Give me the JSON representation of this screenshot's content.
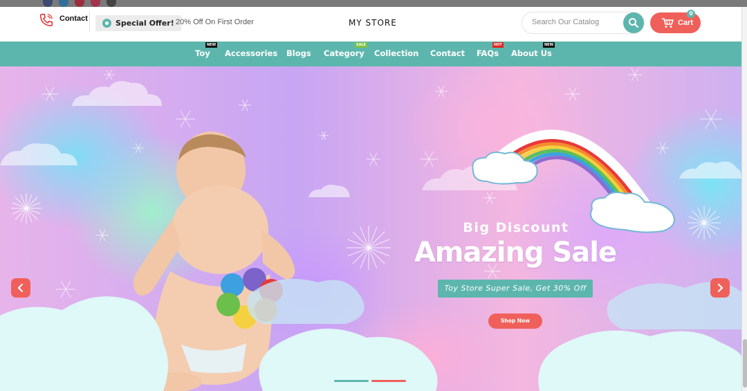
{
  "header": {
    "contact_label": "Contact",
    "special_offer_label": "Special Offer!",
    "offer_text": "20% Off On First Order",
    "store_title": "MY STORE",
    "search_placeholder": "Search Our Catalog",
    "cart_label": "Cart",
    "cart_count": "0"
  },
  "nav": {
    "items": [
      {
        "label": "Toy",
        "tag": "NEW"
      },
      {
        "label": "Accessories",
        "tag": ""
      },
      {
        "label": "Blogs",
        "tag": ""
      },
      {
        "label": "Category",
        "tag": "SALE"
      },
      {
        "label": "Collection",
        "tag": ""
      },
      {
        "label": "Contact",
        "tag": ""
      },
      {
        "label": "FAQs",
        "tag": "HOT"
      },
      {
        "label": "About Us",
        "tag": "NEW"
      }
    ]
  },
  "hero": {
    "subtitle": "Big Discount",
    "title": "Amazing Sale",
    "banner": "Toy Store Super Sale, Get 30% Off",
    "button_label": "Shop Now",
    "active_slide": 1,
    "slide_count": 2
  },
  "colors": {
    "accent_teal": "#5db6ad",
    "accent_coral": "#f0605a",
    "tag_new": "#111111",
    "tag_sale": "#7cc343",
    "tag_hot": "#e0261f"
  },
  "icons": {
    "contact": "phone-icon",
    "offer": "badge-icon",
    "search": "search-icon",
    "cart": "cart-icon",
    "prev": "chevron-left-icon",
    "next": "chevron-right-icon"
  }
}
